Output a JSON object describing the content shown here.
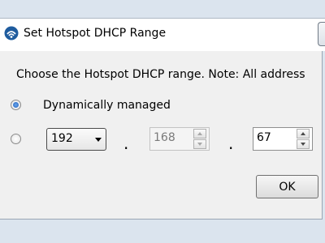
{
  "window": {
    "title": "Set Hotspot DHCP Range",
    "icon": "wifi-hotspot-icon"
  },
  "dialog": {
    "instruction": "Choose the Hotspot DHCP range. Note: All address",
    "options": {
      "dynamic_label": "Dynamically managed",
      "dynamic_selected": true,
      "manual_selected": false
    },
    "octet1": {
      "value": "192",
      "options_visible": [
        "192"
      ]
    },
    "separator": ".",
    "octet2": {
      "value": "168",
      "disabled": true
    },
    "octet3": {
      "value": "67",
      "disabled": false
    },
    "ok_label": "OK"
  }
}
